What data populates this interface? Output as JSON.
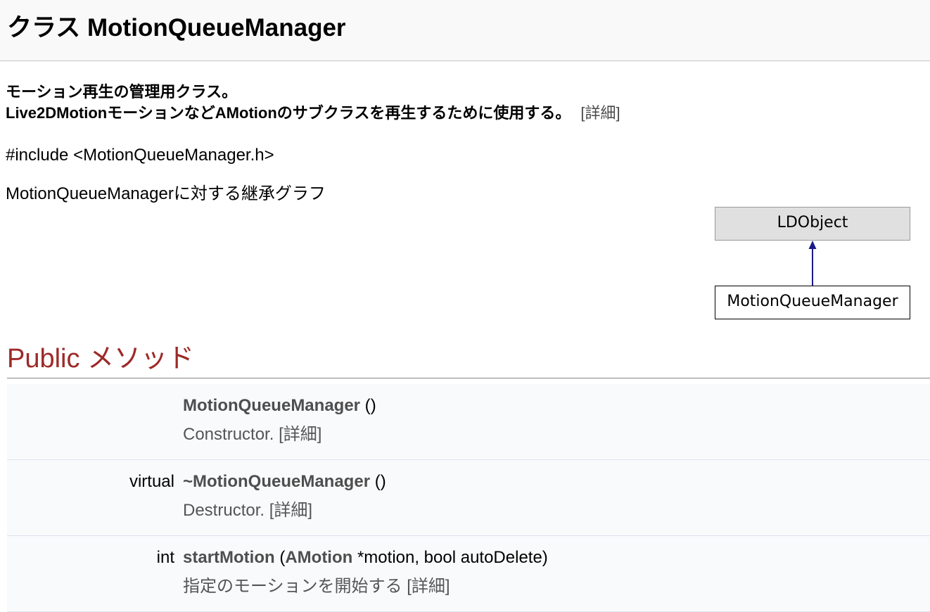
{
  "header": {
    "title": "クラス MotionQueueManager"
  },
  "brief": {
    "line1": "モーション再生の管理用クラス。",
    "line2": "Live2DMotionモーションなどAMotionのサブクラスを再生するために使用する。",
    "more_link": "[詳細]"
  },
  "include_line": "#include <MotionQueueManager.h>",
  "inheritance": {
    "caption": "MotionQueueManagerに対する継承グラフ",
    "base_class": "LDObject",
    "derived_class": "MotionQueueManager"
  },
  "public_methods": {
    "heading": "Public メソッド",
    "members": [
      {
        "type": "",
        "name": "MotionQueueManager",
        "args_open": " (",
        "param_type": "",
        "args_rest": ")",
        "description": "Constructor.",
        "more_link": "[詳細]"
      },
      {
        "type": "virtual",
        "name": "~MotionQueueManager",
        "args_open": " (",
        "param_type": "",
        "args_rest": ")",
        "description": "Destructor.",
        "more_link": "[詳細]"
      },
      {
        "type": "int",
        "name": "startMotion",
        "args_open": " (",
        "param_type": "AMotion",
        "args_rest": " *motion, bool autoDelete)",
        "description": "指定のモーションを開始する",
        "more_link": "[詳細]"
      }
    ]
  },
  "colors": {
    "heading": "#9c2a28",
    "row_background": "#f9fafc",
    "row_divider": "#dee4f0",
    "graph_edge": "#1a1a8c"
  }
}
